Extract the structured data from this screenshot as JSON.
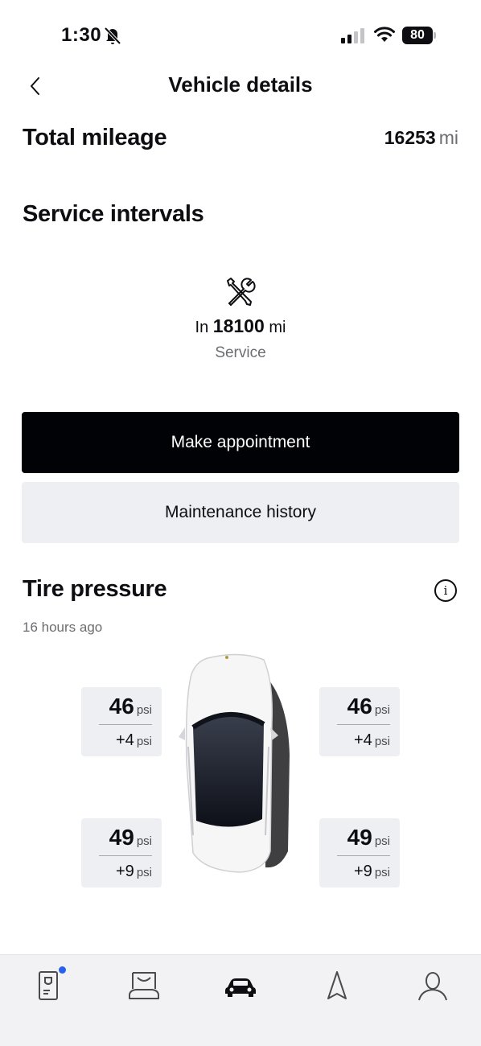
{
  "status_bar": {
    "time": "1:30",
    "battery": "80"
  },
  "header": {
    "title": "Vehicle details"
  },
  "mileage": {
    "title": "Total mileage",
    "value": "16253",
    "unit": "mi"
  },
  "service": {
    "title": "Service intervals",
    "prefix": "In",
    "distance": "18100",
    "unit": "mi",
    "label": "Service"
  },
  "buttons": {
    "appointment": "Make appointment",
    "history": "Maintenance history"
  },
  "tire_pressure": {
    "title": "Tire pressure",
    "info_icon": "i",
    "updated": "16 hours ago",
    "unit": "psi",
    "front_left": {
      "value": "46",
      "delta": "+4"
    },
    "front_right": {
      "value": "46",
      "delta": "+4"
    },
    "rear_left": {
      "value": "49",
      "delta": "+9"
    },
    "rear_right": {
      "value": "49",
      "delta": "+9"
    }
  },
  "tab_bar": {
    "tabs": [
      "phone-key-icon",
      "vehicle-front-icon",
      "car-icon",
      "navigation-icon",
      "profile-icon"
    ],
    "active": "car-icon",
    "badge_color": "#2762ec"
  }
}
